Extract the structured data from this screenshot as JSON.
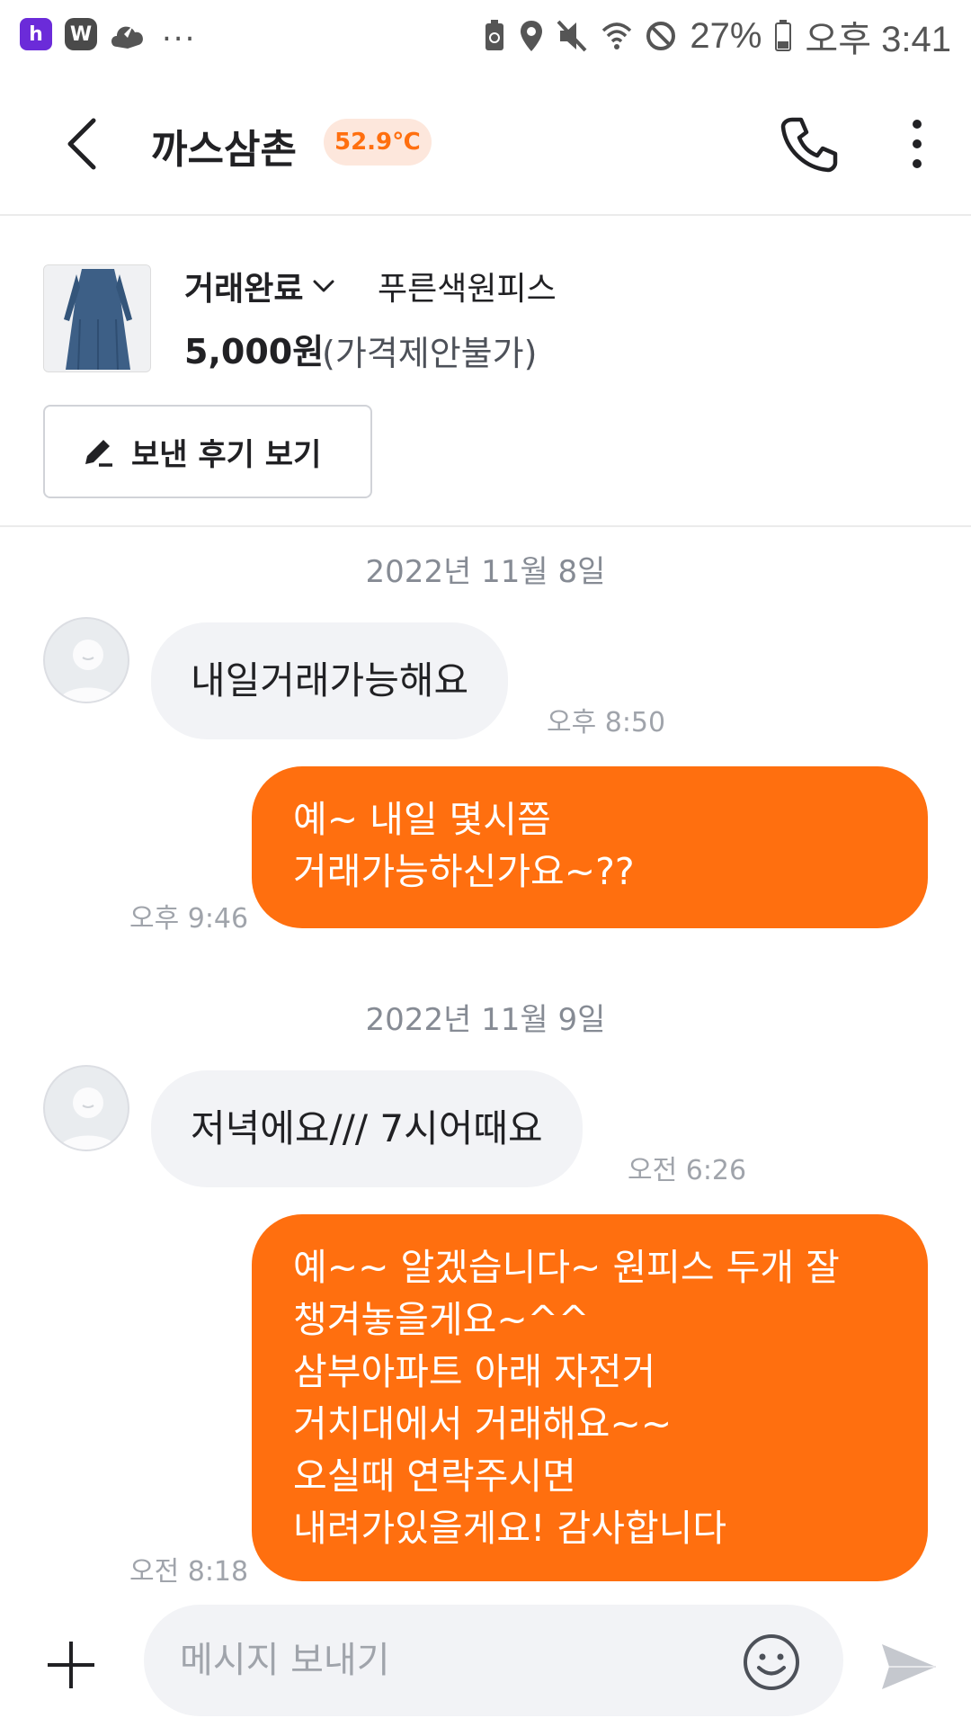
{
  "status_bar": {
    "app1_letter": "h",
    "app2_letter": "W",
    "more_dots": "...",
    "battery_text": "27%",
    "time": "오후 3:41"
  },
  "header": {
    "title": "까스삼촌",
    "temperature": "52.9℃",
    "accent_color": "#ff6f0f"
  },
  "product": {
    "deal_status": "거래완료",
    "name": "푸른색원피스",
    "price": "5,000원",
    "price_note": "(가격제안불가)",
    "review_button_label": "보낸 후기 보기"
  },
  "chat": {
    "dates": [
      "2022년 11월 8일",
      "2022년 11월 9일"
    ],
    "messages": [
      {
        "direction": "in",
        "lines": [
          "내일거래가능해요"
        ],
        "time": "오후 8:50"
      },
      {
        "direction": "out",
        "lines": [
          "예~ 내일 몇시쯤",
          "거래가능하신가요~??"
        ],
        "time": "오후 9:46"
      },
      {
        "direction": "in",
        "lines": [
          "저녁에요/// 7시어때요"
        ],
        "time": "오전 6:26"
      },
      {
        "direction": "out",
        "lines": [
          "예~~ 알겠습니다~ 원피스 두개 잘",
          "챙겨놓을게요~^^",
          "삼부아파트 아래 자전거",
          "거치대에서 거래해요~~",
          "오실때 연락주시면",
          "내려가있을게요! 감사합니다"
        ],
        "time": "오전 8:18"
      }
    ]
  },
  "input_bar": {
    "placeholder": "메시지 보내기"
  }
}
